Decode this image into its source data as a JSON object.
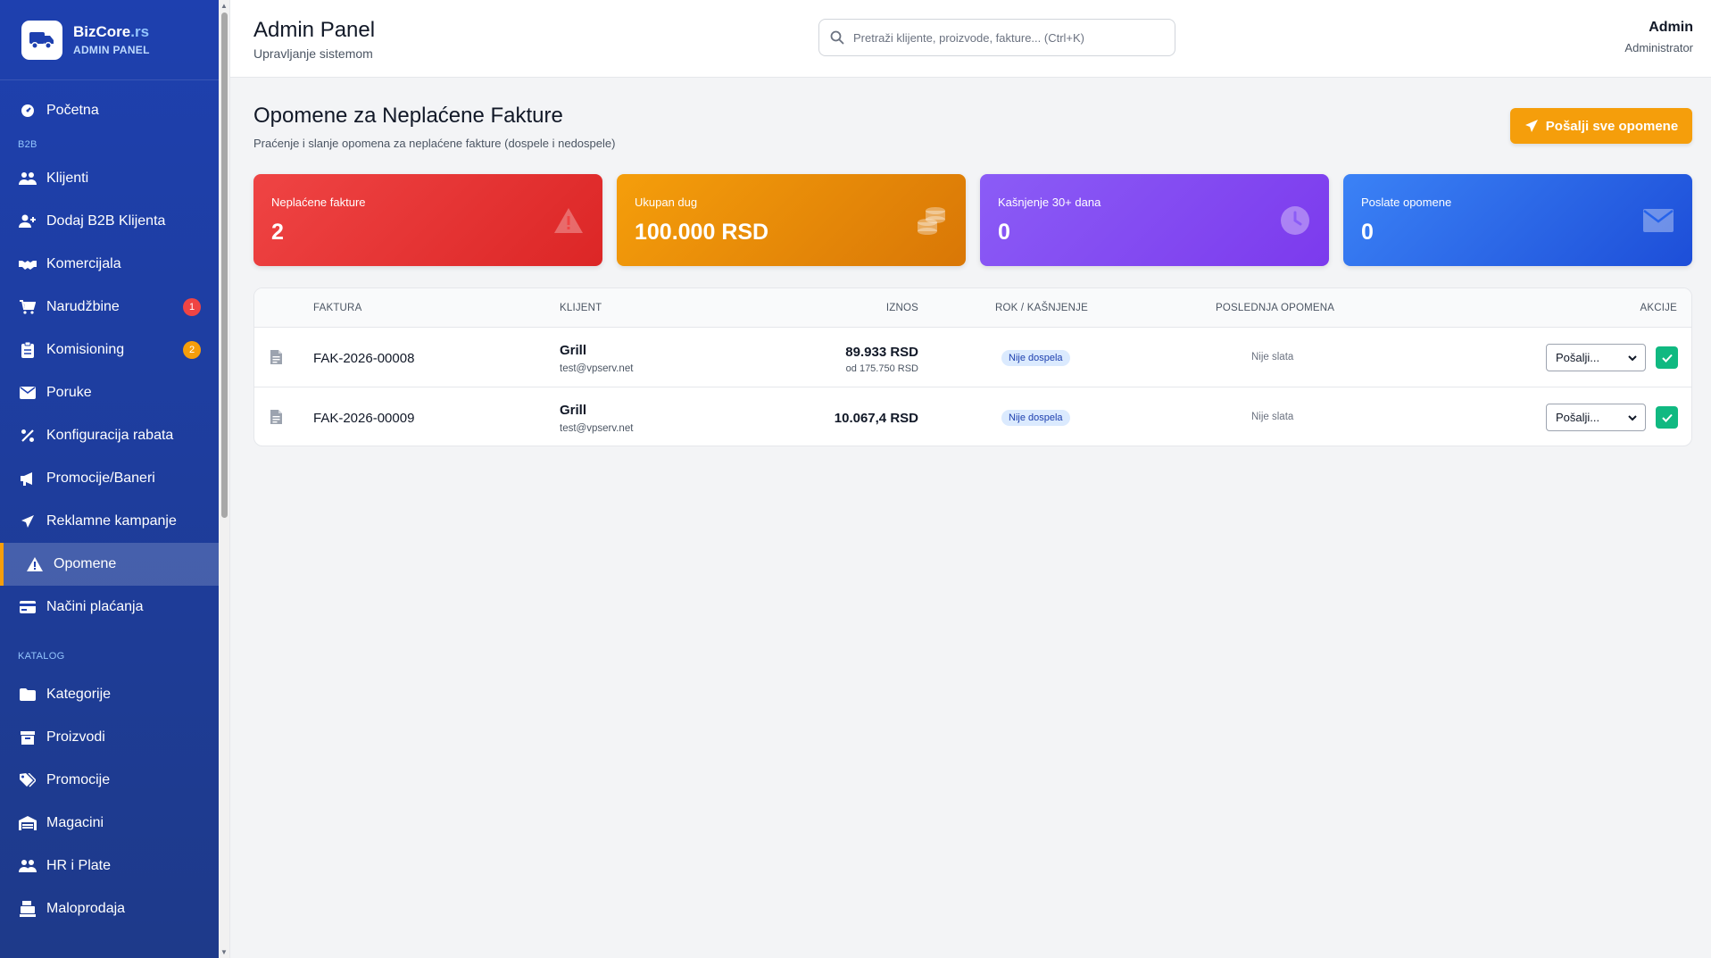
{
  "brand": {
    "name": "BizCore",
    "tld": ".rs",
    "subtitle": "ADMIN PANEL"
  },
  "sidebar": {
    "items": [
      {
        "label": "Početna",
        "icon": "dashboard-icon"
      },
      {
        "section": "B2B"
      },
      {
        "label": "Klijenti",
        "icon": "users-icon"
      },
      {
        "label": "Dodaj B2B Klijenta",
        "icon": "user-plus-icon"
      },
      {
        "label": "Komercijala",
        "icon": "handshake-icon"
      },
      {
        "label": "Narudžbine",
        "icon": "cart-icon",
        "badge": "1",
        "badge_color": "#ef4444"
      },
      {
        "label": "Komisioning",
        "icon": "clipboard-icon",
        "badge": "2",
        "badge_color": "#f59e0b"
      },
      {
        "label": "Poruke",
        "icon": "envelope-icon"
      },
      {
        "label": "Konfiguracija rabata",
        "icon": "percent-icon"
      },
      {
        "label": "Promocije/Baneri",
        "icon": "megaphone-icon"
      },
      {
        "label": "Reklamne kampanje",
        "icon": "paper-plane-icon"
      },
      {
        "label": "Opomene",
        "icon": "warning-icon",
        "active": true
      },
      {
        "label": "Načini plaćanja",
        "icon": "credit-card-icon"
      },
      {
        "section": "KATALOG"
      },
      {
        "label": "Kategorije",
        "icon": "folder-icon"
      },
      {
        "label": "Proizvodi",
        "icon": "box-icon"
      },
      {
        "label": "Promocije",
        "icon": "tags-icon"
      },
      {
        "label": "Magacini",
        "icon": "warehouse-icon"
      },
      {
        "label": "HR i Plate",
        "icon": "users-icon"
      },
      {
        "label": "Maloprodaja",
        "icon": "cash-register-icon"
      }
    ]
  },
  "header": {
    "title": "Admin Panel",
    "subtitle": "Upravljanje sistemom",
    "search_placeholder": "Pretraži klijente, proizvode, fakture... (Ctrl+K)",
    "user_name": "Admin",
    "user_role": "Administrator"
  },
  "page": {
    "title": "Opomene za Neplaćene Fakture",
    "subtitle": "Praćenje i slanje opomena za neplaćene fakture (dospele i nedospele)",
    "send_all_label": "Pošalji sve opomene"
  },
  "stats": [
    {
      "label": "Neplaćene fakture",
      "value": "2",
      "icon": "warning-icon",
      "color": "#ef4444"
    },
    {
      "label": "Ukupan dug",
      "value": "100.000 RSD",
      "icon": "coins-icon",
      "color": "#f59e0b"
    },
    {
      "label": "Kašnjenje 30+ dana",
      "value": "0",
      "icon": "clock-icon",
      "color": "#8b5cf6"
    },
    {
      "label": "Poslate opomene",
      "value": "0",
      "icon": "envelope-icon",
      "color": "#3b82f6"
    }
  ],
  "table": {
    "columns": [
      "FAKTURA",
      "KLIJENT",
      "IZNOS",
      "ROK / KAŠNJENJE",
      "POSLEDNJA OPOMENA",
      "AKCIJE"
    ],
    "rows": [
      {
        "invoice": "FAK-2026-00008",
        "client": "Grill",
        "email": "test@vpserv.net",
        "amount": "89.933 RSD",
        "amount_sub": "od 175.750 RSD",
        "status": "Nije dospela",
        "last_reminder": "Nije slata",
        "action": "Pošalji..."
      },
      {
        "invoice": "FAK-2026-00009",
        "client": "Grill",
        "email": "test@vpserv.net",
        "amount": "10.067,4 RSD",
        "amount_sub": "",
        "status": "Nije dospela",
        "last_reminder": "Nije slata",
        "action": "Pošalji..."
      }
    ]
  }
}
